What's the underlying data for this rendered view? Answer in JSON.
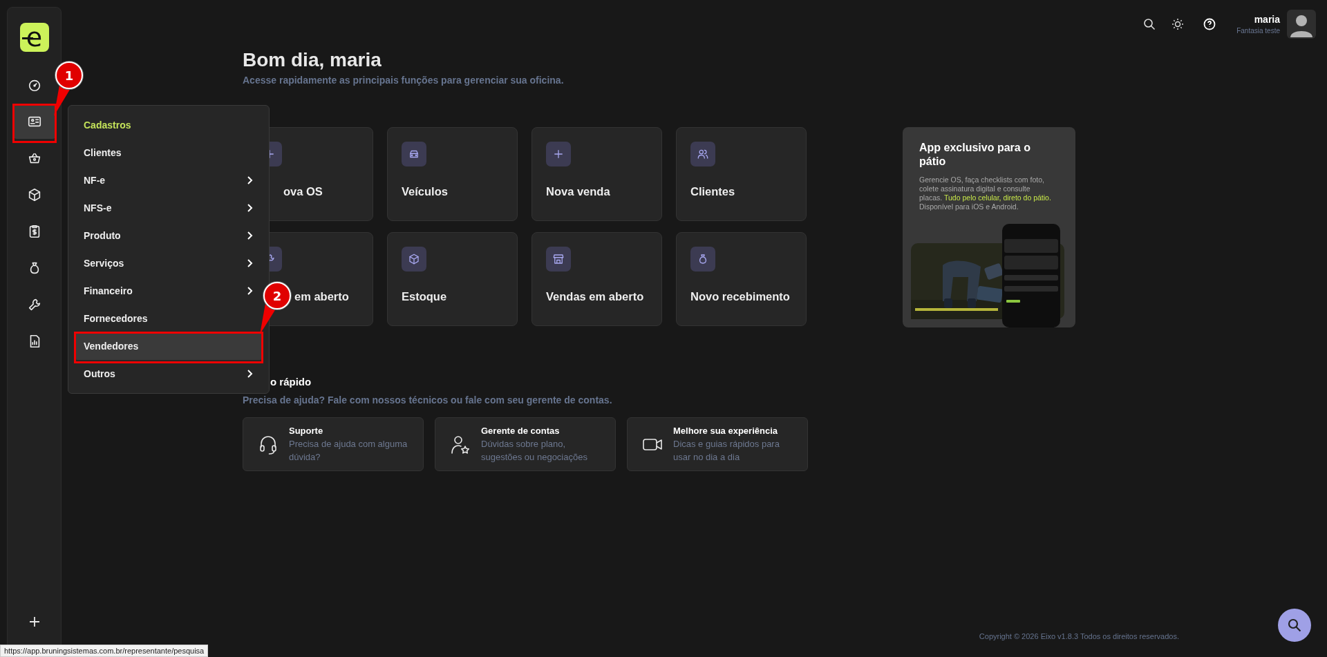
{
  "sidebar": {
    "logo": "e",
    "items": [
      {
        "selected": false
      },
      {
        "selected": true
      },
      {
        "selected": false
      },
      {
        "selected": false
      },
      {
        "selected": false
      },
      {
        "selected": false
      },
      {
        "selected": false
      },
      {
        "selected": false
      }
    ]
  },
  "menu": {
    "title": "Cadastros",
    "items": [
      {
        "label": "Clientes",
        "submenu": false,
        "selected": false
      },
      {
        "label": "NF-e",
        "submenu": true,
        "selected": false
      },
      {
        "label": "NFS-e",
        "submenu": true,
        "selected": false
      },
      {
        "label": "Produto",
        "submenu": true,
        "selected": false
      },
      {
        "label": "Serviços",
        "submenu": true,
        "selected": false
      },
      {
        "label": "Financeiro",
        "submenu": true,
        "selected": false
      },
      {
        "label": "Fornecedores",
        "submenu": false,
        "selected": false
      },
      {
        "label": "Vendedores",
        "submenu": false,
        "selected": true
      },
      {
        "label": "Outros",
        "submenu": true,
        "selected": false
      }
    ]
  },
  "header": {
    "user_name": "maria",
    "company": "Fantasia teste"
  },
  "greeting": "Bom dia, maria",
  "subtitle": "Acesse rapidamente as principais funções para gerenciar sua oficina.",
  "shortcuts": [
    {
      "label": "ova OS"
    },
    {
      "label": "Veículos"
    },
    {
      "label": "Nova venda"
    },
    {
      "label": "Clientes"
    },
    {
      "label": "em aberto"
    },
    {
      "label": "Estoque"
    },
    {
      "label": "Vendas em aberto"
    },
    {
      "label": "Novo recebimento"
    }
  ],
  "promo": {
    "title": "App exclusivo para o pátio",
    "text_before": "Gerencie OS, faça checklists com foto, colete assinatura digital e consulte placas.",
    "highlight": "Tudo pelo celular, direto do pátio.",
    "text_after": "Disponível para iOS e Android."
  },
  "help": {
    "title": "o rápido",
    "subtitle": "Precisa de ajuda? Fale com nossos técnicos ou fale com seu gerente de contas.",
    "cards": [
      {
        "title": "Suporte",
        "text": "Precisa de ajuda com alguma dúvida?"
      },
      {
        "title": "Gerente de contas",
        "text": "Dúvidas sobre plano, sugestões ou negociações"
      },
      {
        "title": "Melhore sua experiência",
        "text": "Dicas e guias rápidos para usar no dia a dia"
      }
    ]
  },
  "footer": {
    "copyright": "Copyright © 2026 Eixo v1.8.3 Todos os direitos reservados."
  },
  "status_bar": {
    "url": "https://app.bruningsistemas.com.br/representante/pesquisa"
  },
  "annotations": [
    {
      "number": "1"
    },
    {
      "number": "2"
    }
  ]
}
